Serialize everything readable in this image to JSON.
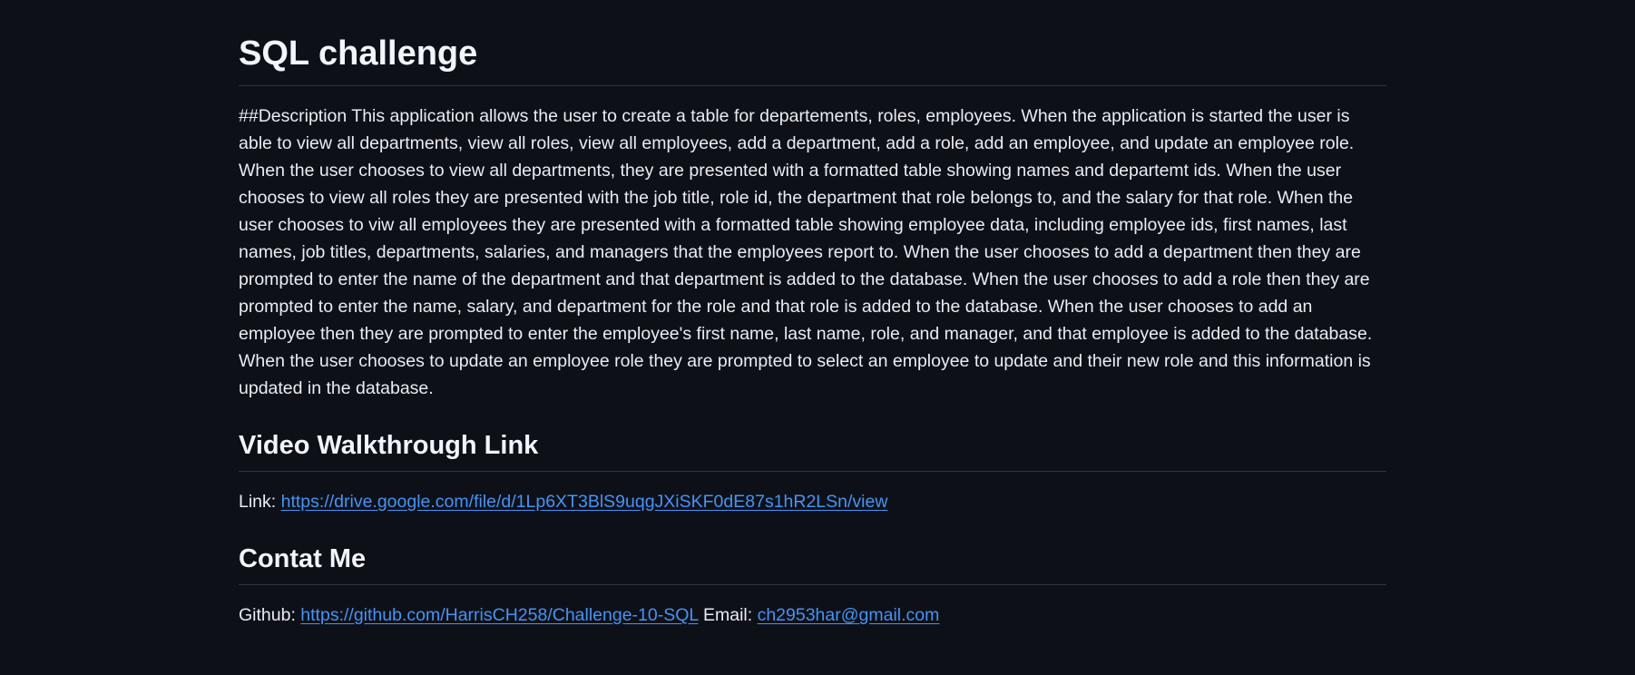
{
  "title": "SQL challenge",
  "description": "##Description This application allows the user to create a table for departements, roles, employees. When the application is started the user is able to view all departments, view all roles, view all employees, add a department, add a role, add an employee, and update an employee role. When the user chooses to view all departments, they are presented with a formatted table showing names and departemt ids. When the user chooses to view all roles they are presented with the job title, role id, the department that role belongs to, and the salary for that role. When the user chooses to viw all employees they are presented with a formatted table showing employee data, including employee ids, first names, last names, job titles, departments, salaries, and managers that the employees report to. When the user chooses to add a department then they are prompted to enter the name of the department and that department is added to the database. When the user chooses to add a role then they are prompted to enter the name, salary, and department for the role and that role is added to the database. When the user chooses to add an employee then they are prompted to enter the employee's first name, last name, role, and manager, and that employee is added to the database. When the user chooses to update an employee role they are prompted to select an employee to update and their new role and this information is updated in the database.",
  "video": {
    "heading": "Video Walkthrough Link",
    "label": "Link:",
    "url": "https://drive.google.com/file/d/1Lp6XT3BlS9uqgJXiSKF0dE87s1hR2LSn/view"
  },
  "contact": {
    "heading": "Contat Me",
    "github_label": "Github:",
    "github_url": "https://github.com/HarrisCH258/Challenge-10-SQL",
    "email_label": "Email:",
    "email": "ch2953har@gmail.com"
  },
  "colors": {
    "background": "#0d1117",
    "text": "#e6edf3",
    "link": "#4493f8",
    "divider": "#30363d"
  }
}
